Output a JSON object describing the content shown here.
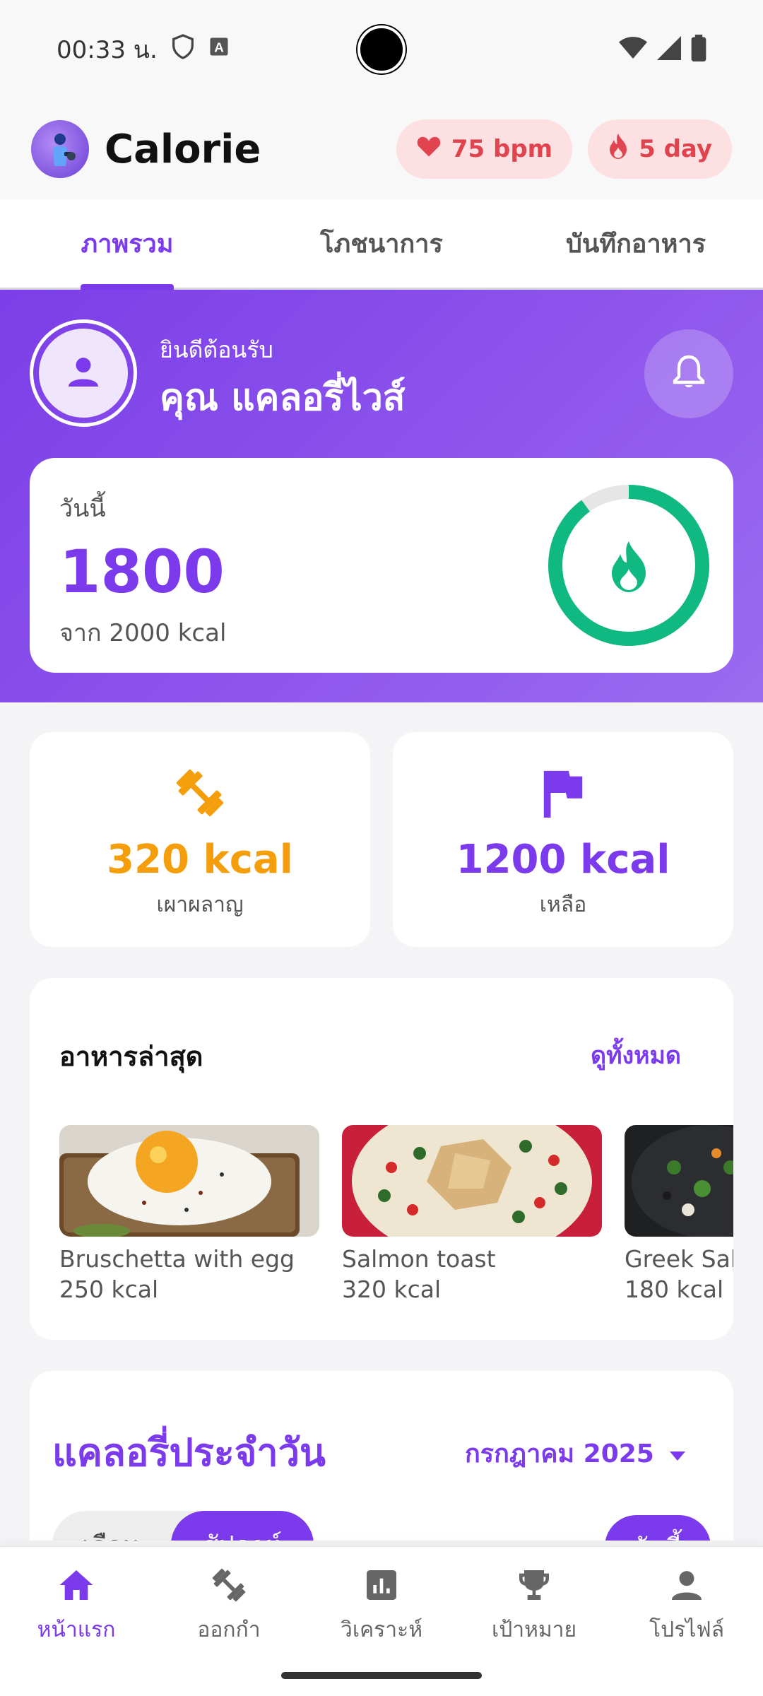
{
  "status_bar": {
    "time": "00:33 น.",
    "icons": [
      "shield-icon",
      "a-keyboard-icon",
      "wifi-icon",
      "signal-icon",
      "battery-icon"
    ]
  },
  "header": {
    "title": "Calorie",
    "heart_rate": "75 bpm",
    "streak": "5 day"
  },
  "tabs": [
    {
      "label": "ภาพรวม",
      "active": true
    },
    {
      "label": "โภชนาการ",
      "active": false
    },
    {
      "label": "บันทึกอาหาร",
      "active": false
    }
  ],
  "hero": {
    "welcome": "ยินดีต้อนรับ",
    "name": "คุณ แคลอรี่ไวส์",
    "today_label": "วันนี้",
    "today_value": "1800",
    "today_of": "จาก 2000 kcal",
    "progress": 0.9
  },
  "stats": {
    "burned": {
      "value": "320 kcal",
      "label": "เผาผลาญ",
      "color": "#f59e0b"
    },
    "remaining": {
      "value": "1200 kcal",
      "label": "เหลือ",
      "color": "#7c3aed"
    }
  },
  "recent": {
    "title": "อาหารล่าสุด",
    "see_all": "ดูทั้งหมด",
    "items": [
      {
        "name": "Bruschetta with egg",
        "kcal": "250 kcal"
      },
      {
        "name": "Salmon toast",
        "kcal": "320 kcal"
      },
      {
        "name": "Greek Sal",
        "kcal": "180 kcal"
      }
    ]
  },
  "daily": {
    "title": "แคลอรี่ประจำวัน",
    "month": "กรกฎาคม 2025",
    "segment_month": "เดือน",
    "segment_week": "สัปดาห์",
    "today_button": "วันนี้"
  },
  "bottom_nav": [
    {
      "label": "หน้าแรก",
      "icon": "home-icon",
      "active": true
    },
    {
      "label": "ออกกำ",
      "icon": "dumbbell-icon",
      "active": false
    },
    {
      "label": "วิเคราะห์",
      "icon": "analytics-icon",
      "active": false
    },
    {
      "label": "เป้าหมาย",
      "icon": "trophy-icon",
      "active": false
    },
    {
      "label": "โปรไฟล์",
      "icon": "person-icon",
      "active": false
    }
  ],
  "colors": {
    "accent": "#7c3aed",
    "ring": "#10b981",
    "badge_text": "#e0454f"
  }
}
